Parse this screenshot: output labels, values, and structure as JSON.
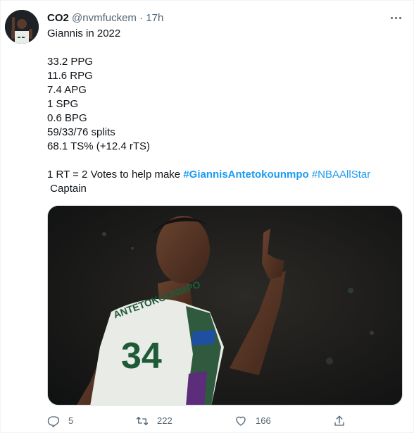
{
  "author": {
    "name": "CO2",
    "handle": "@nvmfuckem",
    "separator": "·",
    "time": "17h"
  },
  "icons": {
    "more": "more-horizontal-icon",
    "reply": "reply-icon",
    "retweet": "retweet-icon",
    "like": "heart-icon",
    "share": "share-icon"
  },
  "tweet": {
    "lines": [
      "Giannis in 2022",
      "33.2 PPG",
      "11.6 RPG",
      "7.4 APG",
      "1 SPG",
      "0.6 BPG",
      "59/33/76 splits",
      "68.1 TS% (+12.4 rTS)"
    ],
    "cta_text": "1 RT = 2 Votes to help make ",
    "hashtag_1": "#GiannisAntetokounmpo",
    "hashtag_2": "#NBAAllStar",
    "cta_end": "Captain"
  },
  "media": {
    "jersey_name": "ANTETOKOUNMPO",
    "jersey_number": "34"
  },
  "actions": {
    "replies": "5",
    "retweets": "222",
    "likes": "166"
  },
  "colors": {
    "link": "#1d9bf0",
    "secondary_text": "#536471",
    "primary_text": "#0f1419"
  }
}
